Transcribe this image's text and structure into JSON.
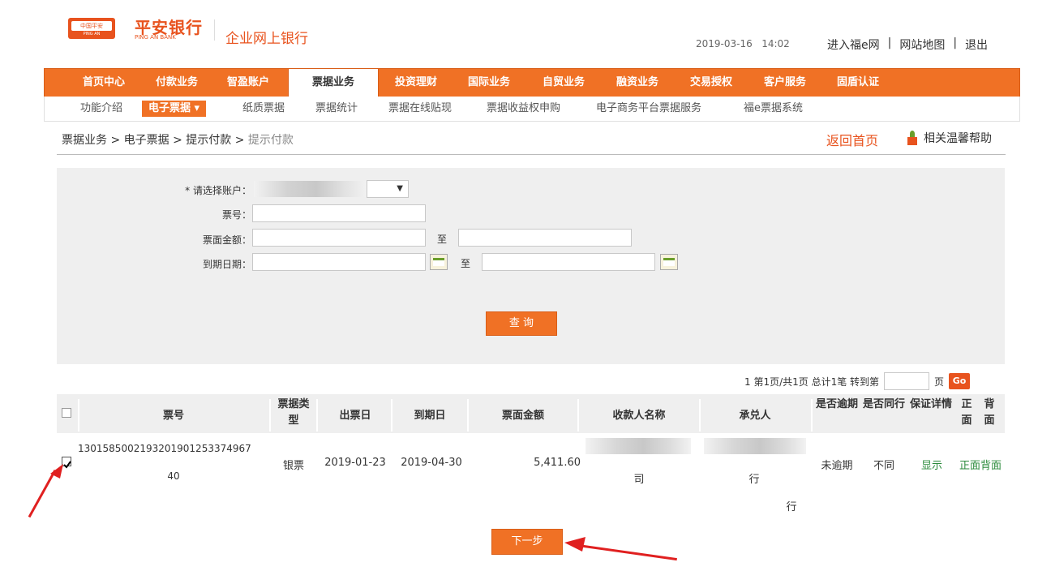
{
  "header": {
    "logo_text": "中国平安",
    "logo_sub": "PING AN",
    "bank_name_cn": "平安银行",
    "bank_name_en": "PING AN BANK",
    "portal_title": "企业网上银行",
    "date": "2019-03-16",
    "time": "14:02",
    "links": [
      "进入福e网",
      "|",
      "网站地图",
      "|",
      "退出"
    ]
  },
  "nav": {
    "items": [
      "首页中心",
      "付款业务",
      "智盈账户",
      "票据业务",
      "投资理财",
      "国际业务",
      "自贸业务",
      "融资业务",
      "交易授权",
      "客户服务",
      "固盾认证"
    ],
    "active": "票据业务"
  },
  "subnav": {
    "items": [
      "功能介绍",
      "电子票据 ▾",
      "纸质票据",
      "票据统计",
      "票据在线贴现",
      "票据收益权申购",
      "电子商务平台票据服务",
      "福e票据系统"
    ],
    "active": "电子票据 ▾"
  },
  "breadcrumb": {
    "path": "票据业务 > 电子票据 > 提示付款 > ",
    "current": "提示付款"
  },
  "top_actions": {
    "home": "返回首页",
    "help": "相关温馨帮助"
  },
  "form": {
    "account_label": "* 请选择账户：",
    "bill_no_label": "票号：",
    "amount_label": "票面金额：",
    "due_date_label": "到期日期：",
    "to": "至",
    "select_arrow": "▼",
    "query_button": "查 询"
  },
  "pager": {
    "text": "1  第1页/共1页 总计1笔 转到第",
    "page_suffix": "页",
    "go": "Go"
  },
  "table": {
    "headers": {
      "bill_no": "票号",
      "bill_type": "票据类型",
      "issue_date": "出票日",
      "due_date": "到期日",
      "amount": "票面金额",
      "payee": "收款人名称",
      "acceptor": "承兑人",
      "overdue": "是否逾期",
      "same_bank": "是否同行",
      "guarantee": "保证详情",
      "front": "正面",
      "back": "背面"
    },
    "rows": [
      {
        "bill_no_line1": "130158500219320190125337496​7",
        "bill_no_line2": "40",
        "bill_type": "银票",
        "issue_date": "2019-01-23",
        "due_date": "2019-04-30",
        "amount": "5,411.60",
        "payee_tail": "司",
        "acceptor_tail": "行",
        "acceptor_tail2": "行",
        "overdue": "未逾期",
        "same_bank": "不同",
        "guarantee": "显示",
        "front_back": "正面背面",
        "checked": true
      }
    ]
  },
  "next_button": "下一步",
  "colors": {
    "accent": "#f07125",
    "brand": "#e8531e",
    "link_green": "#2a8a3a",
    "annotation_arrow": "#e02020"
  }
}
